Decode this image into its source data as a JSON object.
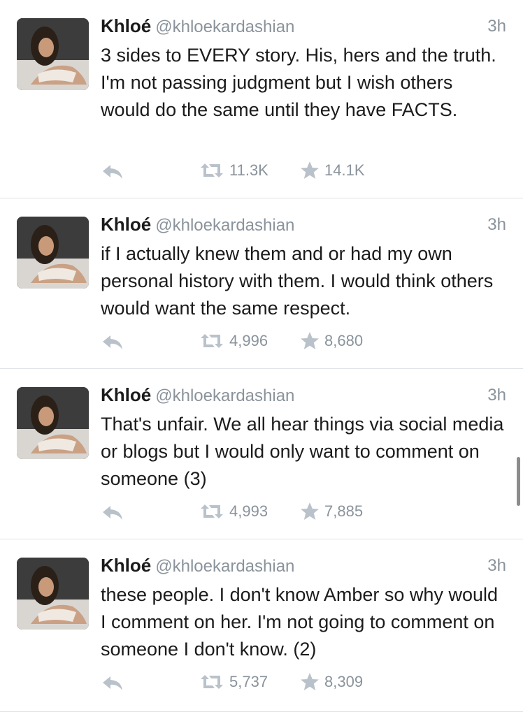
{
  "colors": {
    "meta": "#8a939b",
    "text": "#1b1b1b",
    "divider": "#dfe2e6",
    "icon": "#b9c2ca"
  },
  "icons": {
    "reply": "reply-icon",
    "retweet": "retweet-icon",
    "favorite": "star-icon"
  },
  "tweets": [
    {
      "name": "Khloé",
      "handle": "@khloekardashian",
      "time": "3h",
      "text": "3 sides to EVERY story. His, hers and the truth. I'm not passing judgment but I wish others would do the same until they have FACTS.",
      "retweets": "11.3K",
      "favorites": "14.1K"
    },
    {
      "name": "Khloé",
      "handle": "@khloekardashian",
      "time": "3h",
      "text": "if I actually knew them and or had my own personal history with them. I would think others would want the same respect.",
      "retweets": "4,996",
      "favorites": "8,680"
    },
    {
      "name": "Khloé",
      "handle": "@khloekardashian",
      "time": "3h",
      "text": "That's unfair. We all hear things via social media or blogs but I would only want to comment on someone (3)",
      "retweets": "4,993",
      "favorites": "7,885"
    },
    {
      "name": "Khloé",
      "handle": "@khloekardashian",
      "time": "3h",
      "text": "these people. I don't know Amber so why would I comment on her. I'm not going to comment on someone I don't know. (2)",
      "retweets": "5,737",
      "favorites": "8,309"
    }
  ]
}
